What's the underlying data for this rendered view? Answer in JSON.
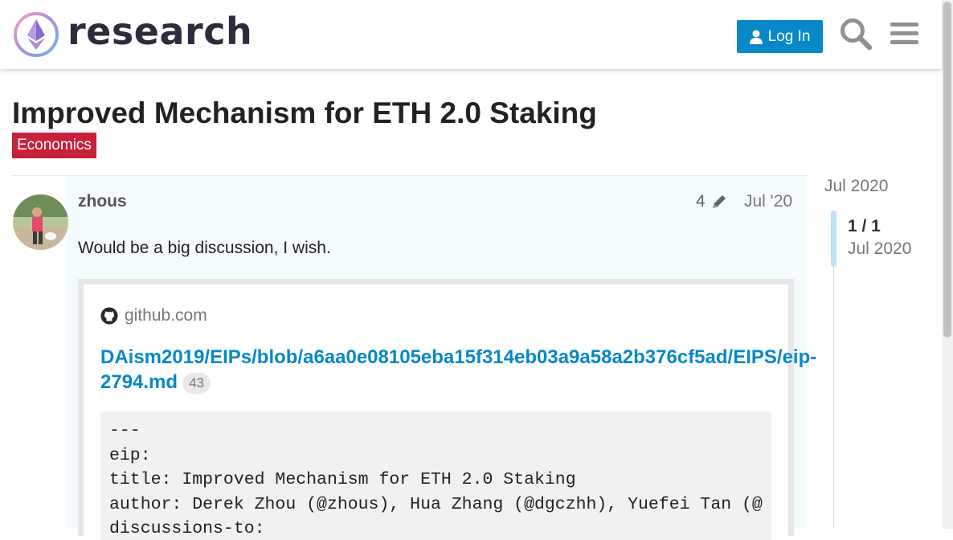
{
  "header": {
    "site_name": "research",
    "login_label": "Log In",
    "icons": [
      "user-icon",
      "search-icon",
      "hamburger-menu-icon"
    ],
    "accent_color": "#0688c9"
  },
  "topic": {
    "title": "Improved Mechanism for ETH 2.0 Staking",
    "category": "Economics",
    "category_color": "#c8213a"
  },
  "post": {
    "username": "zhous",
    "edit_count": "4",
    "date": "Jul '20",
    "text": "Would be a big discussion, I wish.",
    "onebox": {
      "source": "github.com",
      "link_text": "DAism2019/EIPs/blob/a6aa0e08105eba15f314eb03a9a58a2b376cf5ad/EIPS/eip-2794.md",
      "click_count": "43",
      "code_lines": [
        "---",
        "eip:",
        "title: Improved Mechanism for ETH 2.0 Staking",
        "author: Derek Zhou (@zhous), Hua Zhang (@dgczhh), Yuefei Tan (@",
        "discussions-to:"
      ]
    }
  },
  "timeline": {
    "top_date": "Jul 2020",
    "count": "1 / 1",
    "bottom_date": "Jul 2020"
  }
}
